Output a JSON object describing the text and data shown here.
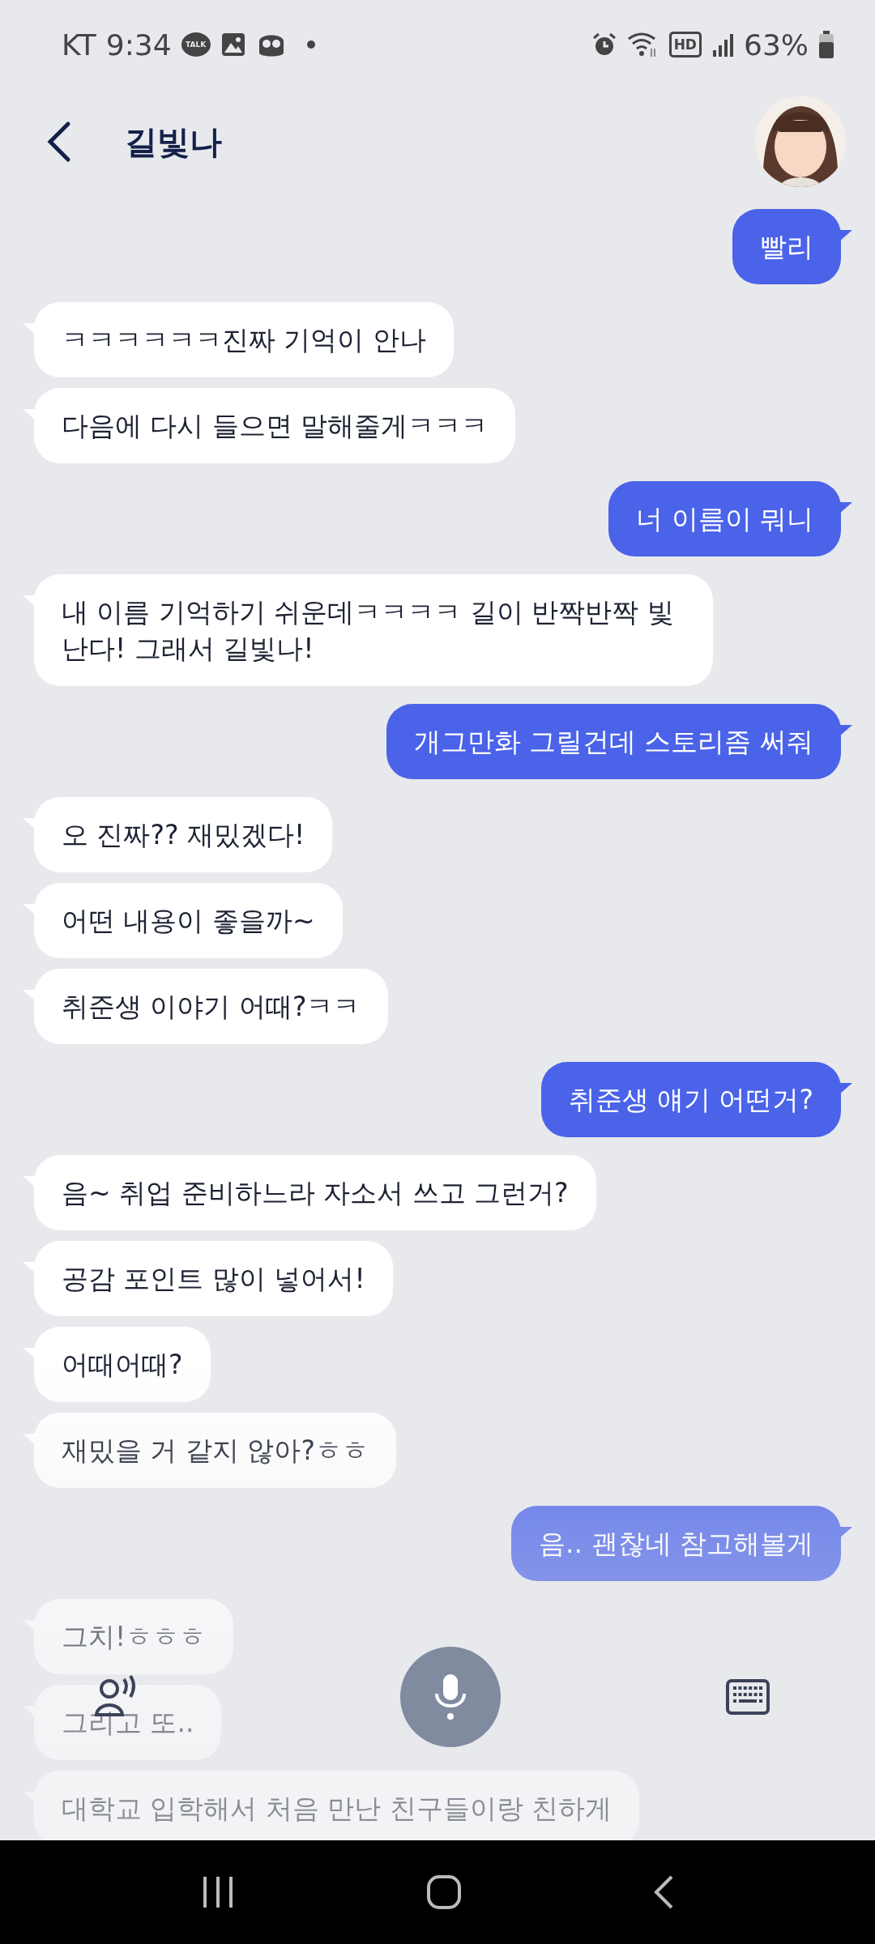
{
  "status_bar": {
    "carrier": "KT",
    "time": "9:34",
    "talk_badge": "TALK",
    "hd_badge": "HD",
    "battery": "63%"
  },
  "header": {
    "title": "길빛나"
  },
  "messages": [
    {
      "kind": "sent",
      "text": "빨리"
    },
    {
      "kind": "received",
      "text": "ㅋㅋㅋㅋㅋㅋ진짜 기억이 안나"
    },
    {
      "kind": "received",
      "text": "다음에 다시 들으면 말해줄게ㅋㅋㅋ"
    },
    {
      "kind": "sent",
      "text": "너 이름이 뭐니"
    },
    {
      "kind": "received",
      "text": "내 이름 기억하기 쉬운데ㅋㅋㅋㅋ 길이 반짝반짝 빛난다! 그래서 길빛나!"
    },
    {
      "kind": "sent",
      "text": "개그만화 그릴건데 스토리좀 써줘"
    },
    {
      "kind": "received",
      "text": "오 진짜?? 재밌겠다!"
    },
    {
      "kind": "received",
      "text": "어떤 내용이 좋을까~"
    },
    {
      "kind": "received",
      "text": "취준생 이야기 어때?ㅋㅋ"
    },
    {
      "kind": "sent",
      "text": "취준생 얘기 어떤거?"
    },
    {
      "kind": "received",
      "text": "음~ 취업 준비하느라 자소서 쓰고 그런거?"
    },
    {
      "kind": "received",
      "text": "공감 포인트 많이 넣어서!"
    },
    {
      "kind": "received",
      "text": "어때어때?"
    },
    {
      "kind": "received",
      "text": "재밌을 거 같지 않아?ㅎㅎ"
    },
    {
      "kind": "sent",
      "text": "음.. 괜찮네 참고해볼게"
    },
    {
      "kind": "received",
      "text": "그치!ㅎㅎㅎ"
    },
    {
      "kind": "received",
      "text": "그리고 또.."
    },
    {
      "kind": "received",
      "text": "대학교 입학해서 처음 만난 친구들이랑 친하게"
    }
  ]
}
